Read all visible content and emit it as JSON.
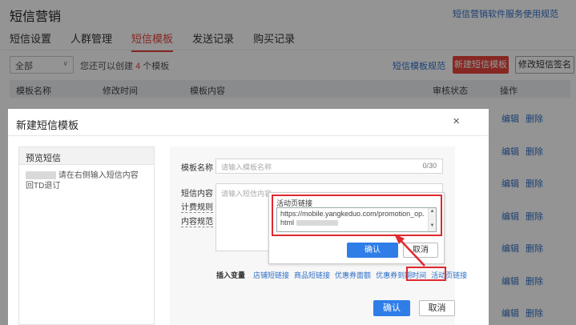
{
  "page": {
    "title": "短信营销",
    "top_link": "短信营销软件服务使用规范",
    "tabs": [
      {
        "label": "短信设置",
        "active": false
      },
      {
        "label": "人群管理",
        "active": false
      },
      {
        "label": "短信模板",
        "active": true
      },
      {
        "label": "发送记录",
        "active": false
      },
      {
        "label": "购买记录",
        "active": false
      }
    ],
    "filter_select": "全部",
    "tip_prefix": "您还可以创建",
    "tip_count": "4",
    "tip_suffix": "个模板",
    "rules_link": "短信模板规范",
    "new_button": "新建短信模板",
    "edit_sign_button": "修改短信签名",
    "columns": [
      "模板名称",
      "修改时间",
      "模板内容",
      "审核状态",
      "操作"
    ],
    "row_actions": {
      "edit": "编辑",
      "delete": "删除"
    }
  },
  "modal": {
    "title": "新建短信模板",
    "close": "×",
    "preview_title": "预览短信",
    "preview_text": "请在右侧输入短信内容 回TD退订",
    "name_label": "模板名称",
    "name_placeholder": "请输入模板名称",
    "name_counter": "0/30",
    "content_label": "短信内容",
    "billing_rule": "计费规则",
    "content_rule": "内容规范",
    "content_placeholder": "请输入短信内容",
    "vars_label": "插入变量",
    "vars": [
      "店铺短链接",
      "商品短链接",
      "优惠券面额",
      "优惠券到期时间",
      "活动页链接"
    ],
    "ok": "确认",
    "cancel": "取消"
  },
  "popover": {
    "label": "活动页链接",
    "url_value": "https://mobile.yangkeduo.com/promotion_op.html",
    "ok": "确认",
    "cancel": "取消"
  },
  "colors": {
    "accent_red": "#e8443b",
    "primary_blue": "#2f7ee8",
    "annotation_red": "#e0282e"
  }
}
